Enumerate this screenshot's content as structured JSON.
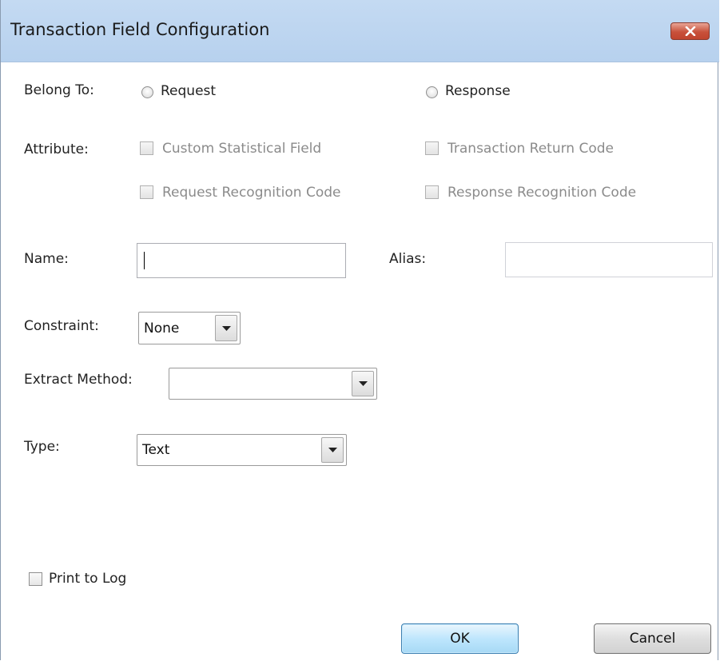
{
  "window": {
    "title": "Transaction Field Configuration",
    "close_icon": "close-icon"
  },
  "belong_to": {
    "label": "Belong To:",
    "options": [
      "Request",
      "Response"
    ]
  },
  "attribute": {
    "label": "Attribute:",
    "checkboxes": [
      "Custom Statistical Field",
      "Transaction Return Code",
      "Request Recognition Code",
      "Response Recognition Code"
    ]
  },
  "name": {
    "label": "Name:",
    "value": ""
  },
  "alias": {
    "label": "Alias:",
    "value": ""
  },
  "constraint": {
    "label": "Constraint:",
    "value": "None"
  },
  "extract_method": {
    "label": "Extract Method:",
    "value": ""
  },
  "type": {
    "label": "Type:",
    "value": "Text"
  },
  "print_to_log": {
    "label": "Print to Log"
  },
  "buttons": {
    "ok": "OK",
    "cancel": "Cancel"
  }
}
